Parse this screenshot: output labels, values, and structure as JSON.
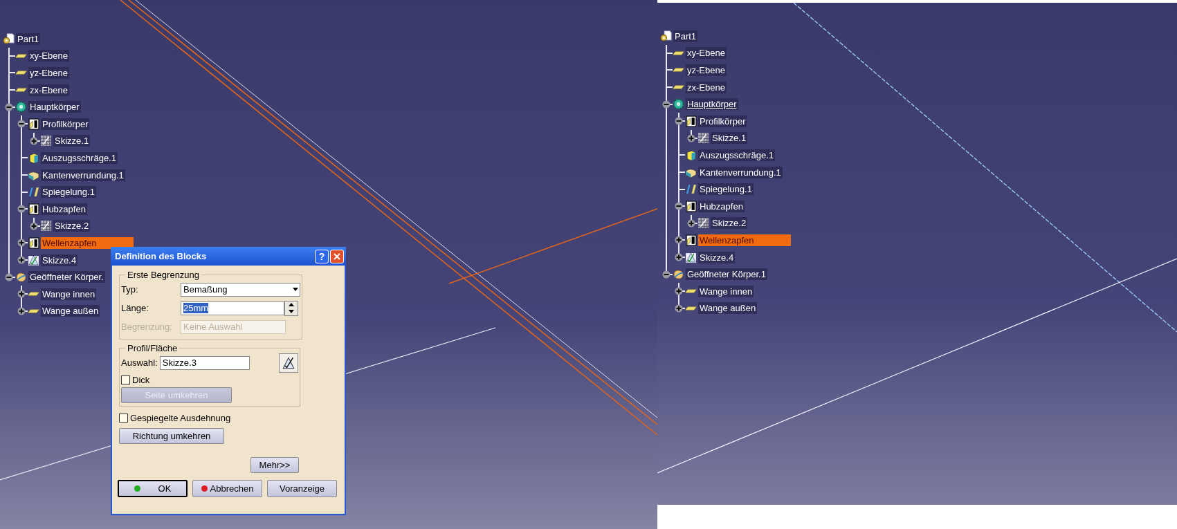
{
  "left_view": {
    "tree": {
      "label": "Part1",
      "kind": "part",
      "selected": false,
      "current": false,
      "children": [
        {
          "label": "xy-Ebene",
          "kind": "plane",
          "selected": false,
          "current": false
        },
        {
          "label": "yz-Ebene",
          "kind": "plane",
          "selected": false,
          "current": false
        },
        {
          "label": "zx-Ebene",
          "kind": "plane",
          "selected": false,
          "current": false
        },
        {
          "label": "Hauptkörper",
          "kind": "body",
          "expanded": true,
          "selected": false,
          "current": false,
          "children": [
            {
              "label": "Profilkörper",
              "kind": "pad",
              "expanded": true,
              "selected": false,
              "current": false,
              "children": [
                {
                  "label": "Skizze.1",
                  "kind": "hatched",
                  "expanded": false,
                  "selected": false,
                  "current": false
                }
              ]
            },
            {
              "label": "Auszugsschräge.1",
              "kind": "draft",
              "selected": false,
              "current": false
            },
            {
              "label": "Kantenverrundung.1",
              "kind": "fillet",
              "selected": false,
              "current": false
            },
            {
              "label": "Spiegelung.1",
              "kind": "mirror",
              "selected": false,
              "current": false
            },
            {
              "label": "Hubzapfen",
              "kind": "pad",
              "expanded": true,
              "selected": false,
              "current": false,
              "children": [
                {
                  "label": "Skizze.2",
                  "kind": "hatched",
                  "expanded": false,
                  "selected": false,
                  "current": false
                }
              ]
            },
            {
              "label": "Wellenzapfen",
              "kind": "pad",
              "expanded": false,
              "selected": true,
              "current": false
            },
            {
              "label": "Skizze.4",
              "kind": "sketch",
              "expanded": false,
              "selected": false,
              "current": false
            }
          ]
        },
        {
          "label": "Geöffneter Körper.",
          "kind": "open",
          "expanded": true,
          "selected": false,
          "current": false,
          "children": [
            {
              "label": "Wange innen",
              "kind": "plane",
              "expanded": false,
              "selected": false,
              "current": false
            },
            {
              "label": "Wange außen",
              "kind": "plane",
              "expanded": false,
              "selected": false,
              "current": false
            }
          ]
        }
      ]
    },
    "dialog": {
      "title": "Definition des Blocks",
      "help": "?",
      "first_limit": {
        "legend": "Erste Begrenzung",
        "type": {
          "label": "Typ:",
          "value": "Bemaßung"
        },
        "length": {
          "label": "Länge:",
          "value": "25mm",
          "text_selected": true
        },
        "limit": {
          "label": "Begrenzung:",
          "value": "Keine Auswahl",
          "disabled": true
        }
      },
      "profile": {
        "legend": "Profil/Fläche",
        "selection": {
          "label": "Auswahl:",
          "value": "Skizze.3"
        },
        "thick": {
          "label": "Dick",
          "checked": false
        },
        "reverse_side": {
          "label": "Seite umkehren",
          "disabled": true
        }
      },
      "mirrored": {
        "label": "Gespiegelte Ausdehnung",
        "checked": false
      },
      "reverse_direction": {
        "label": "Richtung umkehren",
        "disabled": false
      },
      "more": {
        "label": "Mehr>>"
      },
      "buttons": [
        {
          "label": "OK",
          "kind": "ok"
        },
        {
          "label": "Abbrechen",
          "kind": "cancel"
        },
        {
          "label": "Voranzeige",
          "kind": "plain"
        }
      ]
    }
  },
  "right_view": {
    "tree": {
      "label": "Part1",
      "kind": "part",
      "selected": false,
      "current": false,
      "children": [
        {
          "label": "xy-Ebene",
          "kind": "plane",
          "selected": false,
          "current": false
        },
        {
          "label": "yz-Ebene",
          "kind": "plane",
          "selected": false,
          "current": false
        },
        {
          "label": "zx-Ebene",
          "kind": "plane",
          "selected": false,
          "current": false
        },
        {
          "label": "Hauptkörper",
          "kind": "body",
          "expanded": true,
          "selected": false,
          "current": true,
          "children": [
            {
              "label": "Profilkörper",
              "kind": "pad",
              "expanded": true,
              "selected": false,
              "current": false,
              "children": [
                {
                  "label": "Skizze.1",
                  "kind": "hatched",
                  "expanded": false,
                  "selected": false,
                  "current": false
                }
              ]
            },
            {
              "label": "Auszugsschräge.1",
              "kind": "draft",
              "selected": false,
              "current": false
            },
            {
              "label": "Kantenverrundung.1",
              "kind": "fillet",
              "selected": false,
              "current": false
            },
            {
              "label": "Spiegelung.1",
              "kind": "mirror",
              "selected": false,
              "current": false
            },
            {
              "label": "Hubzapfen",
              "kind": "pad",
              "expanded": true,
              "selected": false,
              "current": false,
              "children": [
                {
                  "label": "Skizze.2",
                  "kind": "hatched",
                  "expanded": false,
                  "selected": false,
                  "current": false
                }
              ]
            },
            {
              "label": "Wellenzapfen",
              "kind": "pad",
              "expanded": false,
              "selected": true,
              "current": false
            },
            {
              "label": "Skizze.4",
              "kind": "sketch",
              "expanded": false,
              "selected": false,
              "current": false
            }
          ]
        },
        {
          "label": "Geöffneter Körper.1",
          "kind": "open",
          "expanded": true,
          "selected": false,
          "current": false,
          "children": [
            {
              "label": "Wange innen",
              "kind": "plane",
              "expanded": false,
              "selected": false,
              "current": false
            },
            {
              "label": "Wange außen",
              "kind": "plane",
              "expanded": false,
              "selected": false,
              "current": false
            }
          ]
        }
      ]
    }
  }
}
